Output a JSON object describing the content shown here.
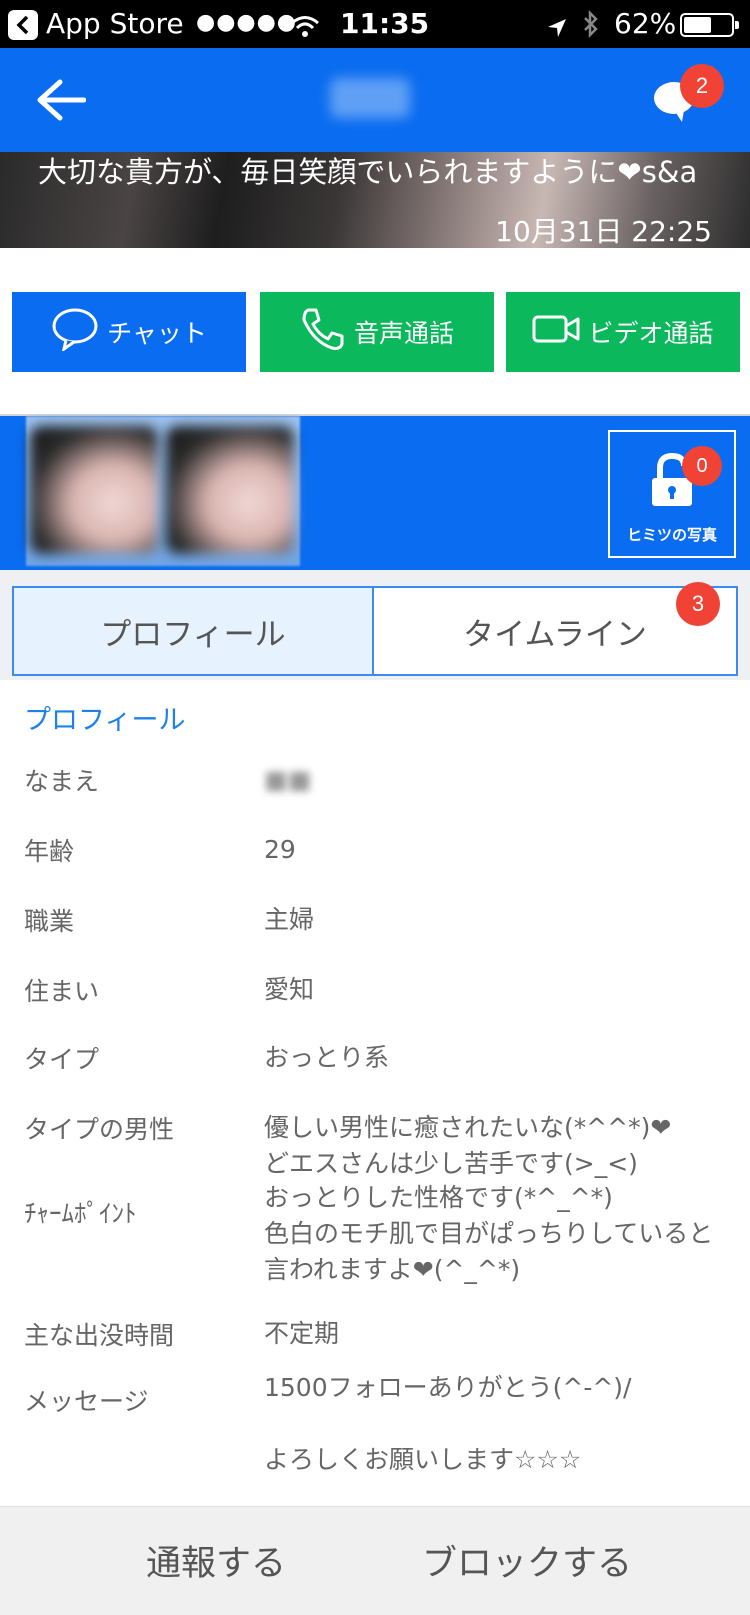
{
  "status_bar": {
    "carrier": "App Store",
    "signal": "●●●●●",
    "time": "11:35",
    "battery_pct": "62%",
    "battery_level": 0.62
  },
  "nav": {
    "title": "■■",
    "chat_badge": "2"
  },
  "banner": {
    "text": "大切な貴方が、毎日笑顔でいられますように❤s&a",
    "date": "10月31日 22:25"
  },
  "actions": {
    "chat": "チャット",
    "voice": "音声通話",
    "video": "ビデオ通話"
  },
  "photos": {
    "secret_label": "ヒミツの写真",
    "secret_count": "0"
  },
  "tabs": {
    "profile": "プロフィール",
    "timeline": "タイムライン",
    "timeline_badge": "3"
  },
  "profile": {
    "section_title": "プロフィール",
    "rows": [
      {
        "label": "なまえ",
        "value": "■■"
      },
      {
        "label": "年齢",
        "value": "29"
      },
      {
        "label": "職業",
        "value": "主婦"
      },
      {
        "label": "住まい",
        "value": "愛知"
      },
      {
        "label": "タイプ",
        "value": "おっとり系"
      },
      {
        "label": "タイプの男性",
        "value": "優しい男性に癒されたいな(*^^*)❤\nどエスさんは少し苦手です(>_<)"
      },
      {
        "label": "ﾁｬｰﾑﾎﾟｲﾝﾄ",
        "value": "おっとりした性格です(*^_^*)\n色白のモチ肌で目がぱっちりしていると言われますよ❤(^_^*)"
      },
      {
        "label": "主な出没時間",
        "value": "不定期"
      },
      {
        "label": "メッセージ",
        "value": "1500フォローありがとう(^-^)/\n\nよろしくお願いします☆☆☆"
      }
    ]
  },
  "footer": {
    "report": "通報する",
    "block": "ブロックする"
  },
  "colors": {
    "primary_blue": "#0a6cf0",
    "call_green": "#0bb85c",
    "badge_red": "#f14236",
    "section_title_blue": "#1c82ea"
  }
}
